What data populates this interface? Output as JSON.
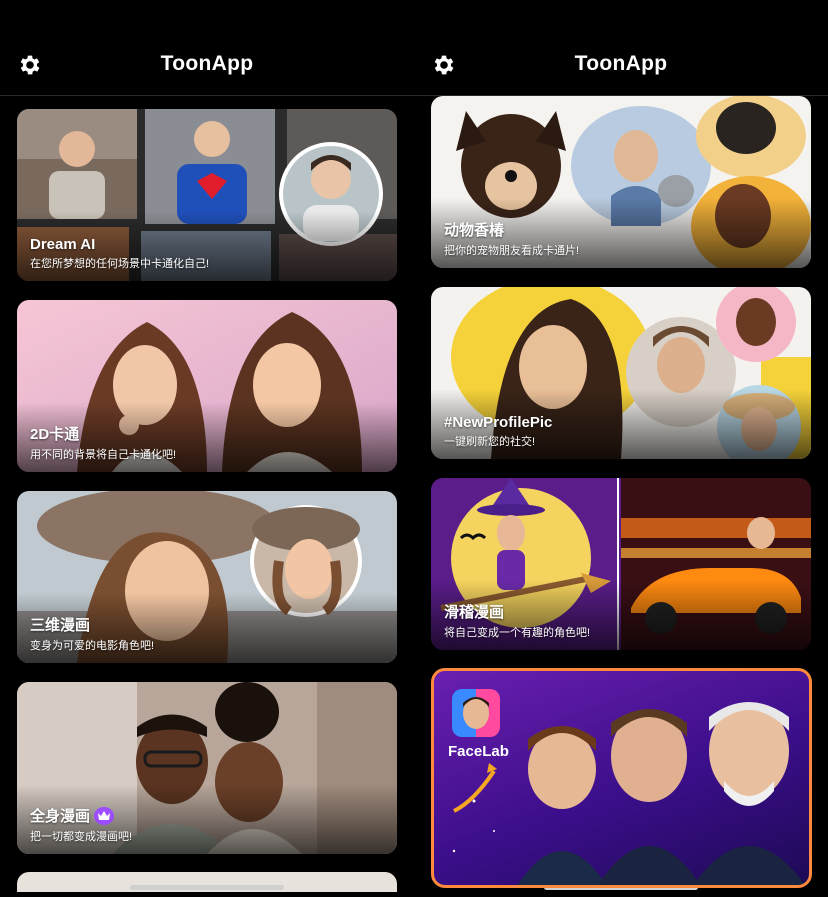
{
  "app": {
    "title": "ToonApp"
  },
  "left_cards": [
    {
      "title": "Dream AI",
      "subtitle": "在您所梦想的任何场景中卡通化自己!"
    },
    {
      "title": "2D卡通",
      "subtitle": "用不同的背景将自己卡通化吧!"
    },
    {
      "title": "三维漫画",
      "subtitle": "变身为可爱的电影角色吧!"
    },
    {
      "title": "全身漫画",
      "subtitle": "把一切都变成漫画吧!",
      "premium": true
    }
  ],
  "right_cards": [
    {
      "title": "动物香椿",
      "subtitle": "把你的宠物朋友看成卡通片!"
    },
    {
      "title": "#NewProfilePic",
      "subtitle": "一键刷新您的社交!"
    },
    {
      "title": "滑稽漫画",
      "subtitle": "将自己变成一个有趣的角色吧!"
    }
  ],
  "promo": {
    "name": "FaceLab"
  },
  "colors": {
    "accent_purple": "#9b4dff",
    "promo_border": "#ff8a3d",
    "background": "#000000"
  },
  "icons": {
    "settings": "gear-icon",
    "premium": "crown-icon"
  }
}
